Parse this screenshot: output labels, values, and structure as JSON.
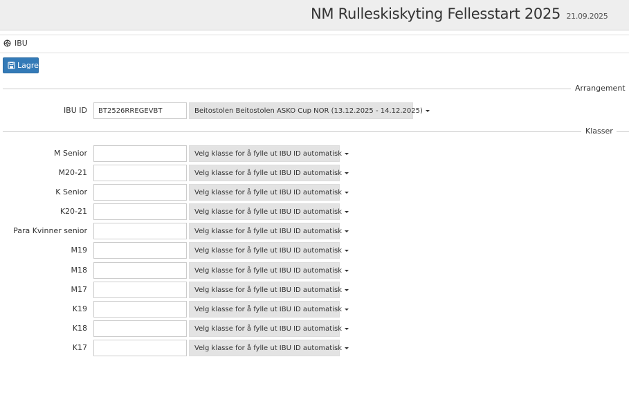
{
  "header": {
    "title": "NM Rulleskiskyting Fellesstart 2025",
    "date": "21.09.2025"
  },
  "subnav": {
    "label": "IBU",
    "icon": "gear-icon"
  },
  "toolbar": {
    "save_label": "Lagre"
  },
  "sections": {
    "arrangement": "Arrangement",
    "klasser": "Klasser"
  },
  "ibu": {
    "label": "IBU ID",
    "value": "BT2526RREGEVBT",
    "event_select": "Beitostolen Beitostolen ASKO Cup NOR (13.12.2025 - 14.12.2025)"
  },
  "class_dropdown_label": "Velg klasse for å fylle ut IBU ID automatisk",
  "classes": [
    {
      "label": "M Senior",
      "value": ""
    },
    {
      "label": "M20-21",
      "value": ""
    },
    {
      "label": "K Senior",
      "value": ""
    },
    {
      "label": "K20-21",
      "value": ""
    },
    {
      "label": "Para Kvinner senior",
      "value": ""
    },
    {
      "label": "M19",
      "value": ""
    },
    {
      "label": "M18",
      "value": ""
    },
    {
      "label": "M17",
      "value": ""
    },
    {
      "label": "K19",
      "value": ""
    },
    {
      "label": "K18",
      "value": ""
    },
    {
      "label": "K17",
      "value": ""
    }
  ],
  "colors": {
    "primary": "#337ab7",
    "header_bg": "#eeeeee",
    "dropdown_bg": "#e3e3e3"
  }
}
